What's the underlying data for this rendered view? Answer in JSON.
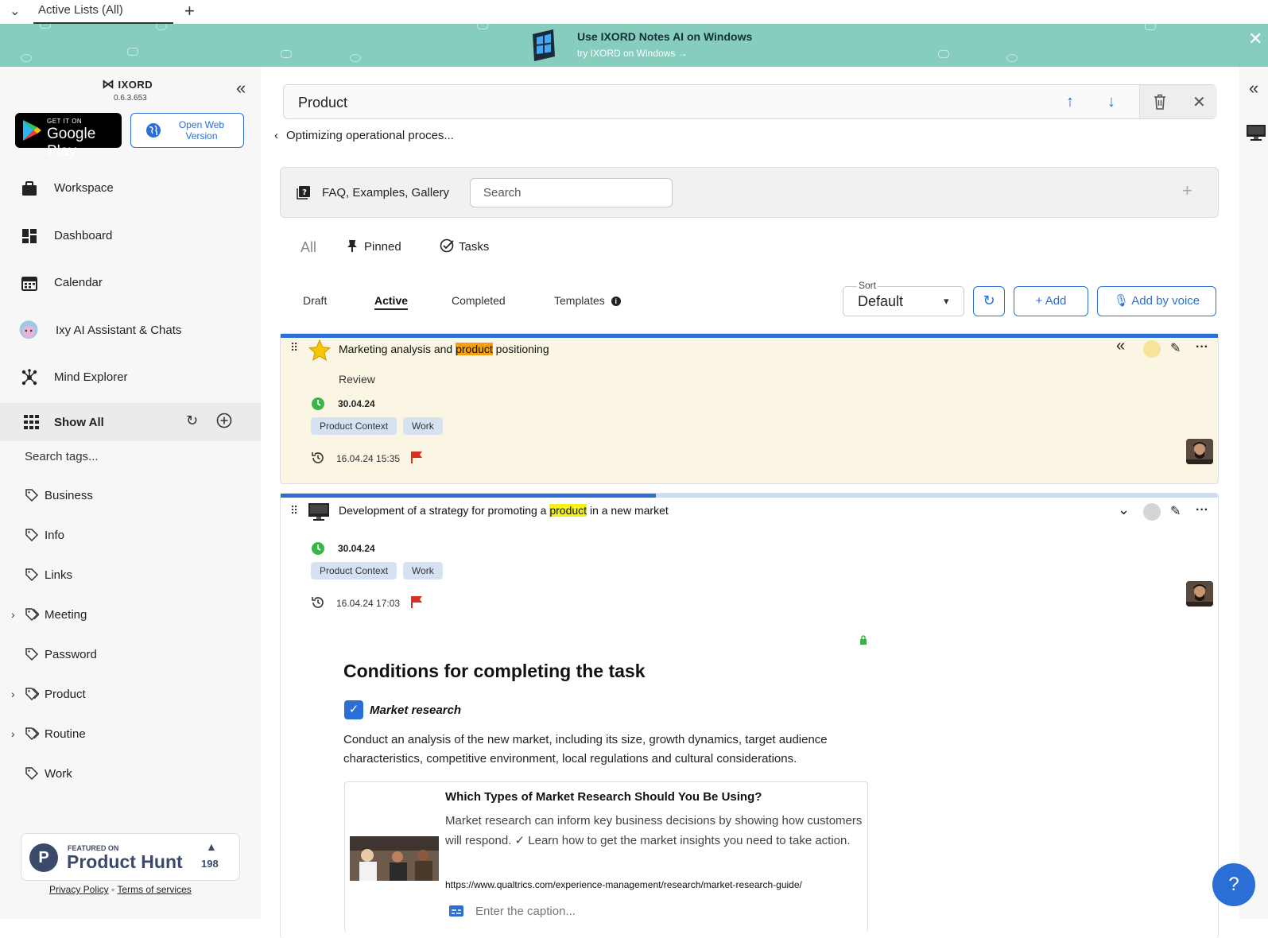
{
  "tabbar": {
    "tab_label": "Active Lists (All)"
  },
  "banner": {
    "title": "Use IXORD Notes AI on Windows",
    "subtitle": "try IXORD on Windows →"
  },
  "sidebar": {
    "brand": "IXORD",
    "version": "0.6.3.653",
    "gplay_small": "GET IT ON",
    "gplay_big": "Google Play",
    "open_web": "Open Web Version",
    "nav": [
      {
        "label": "Workspace",
        "icon": "briefcase-icon"
      },
      {
        "label": "Dashboard",
        "icon": "dashboard-icon"
      },
      {
        "label": "Calendar",
        "icon": "calendar-icon"
      },
      {
        "label": "Ixy AI Assistant & Chats",
        "icon": "assistant-avatar-icon"
      },
      {
        "label": "Mind Explorer",
        "icon": "mind-map-icon"
      }
    ],
    "show_all": "Show All",
    "search_tags": "Search tags...",
    "tags": [
      {
        "label": "Business",
        "expandable": false
      },
      {
        "label": "Info",
        "expandable": false
      },
      {
        "label": "Links",
        "expandable": false
      },
      {
        "label": "Meeting",
        "expandable": true
      },
      {
        "label": "Password",
        "expandable": false
      },
      {
        "label": "Product",
        "expandable": true
      },
      {
        "label": "Routine",
        "expandable": true
      },
      {
        "label": "Work",
        "expandable": false
      }
    ],
    "producthunt": {
      "featured": "FEATURED ON",
      "name": "Product Hunt",
      "count": "198",
      "letter": "P"
    },
    "privacy": "Privacy Policy",
    "terms": "Terms of services"
  },
  "main": {
    "search_value": "Product",
    "breadcrumb": "Optimizing operational proces...",
    "faq_label": "FAQ, Examples, Gallery",
    "faq_search_placeholder": "Search",
    "filters": {
      "all": "All",
      "pinned": "Pinned",
      "tasks": "Tasks"
    },
    "status_tabs": [
      "Draft",
      "Active",
      "Completed",
      "Templates"
    ],
    "active_tab": "Active",
    "sort": {
      "label": "Sort",
      "value": "Default"
    },
    "add_label": "Add",
    "add_voice_label": "Add by voice"
  },
  "cards": [
    {
      "title_pre": "Marketing analysis and ",
      "title_hl": "product",
      "title_post": " positioning",
      "subtitle": "Review",
      "date": "30.04.24",
      "chips": [
        "Product Context",
        "Work"
      ],
      "history": "16.04.24 15:35",
      "progress": 1.0
    },
    {
      "title_pre": "Development of a strategy for promoting a ",
      "title_hl": "product",
      "title_post": " in a new market",
      "date": "30.04.24",
      "chips": [
        "Product Context",
        "Work"
      ],
      "history": "16.04.24 17:03",
      "progress": 0.4,
      "conditions_title": "Conditions for completing the task",
      "checklist_item": "Market research",
      "description": "Conduct an analysis of the new market, including its size, growth dynamics, target audience characteristics, competitive environment, local regulations and cultural considerations.",
      "link": {
        "title": "Which Types of Market Research Should You Be Using?",
        "desc": "Market research can inform key business decisions by showing how customers will respond. ✓ Learn how to get the market insights you need to take action.",
        "url": "https://www.qualtrics.com/experience-management/research/market-research-guide/",
        "caption_placeholder": "Enter the caption..."
      }
    }
  ],
  "help_label": "?"
}
